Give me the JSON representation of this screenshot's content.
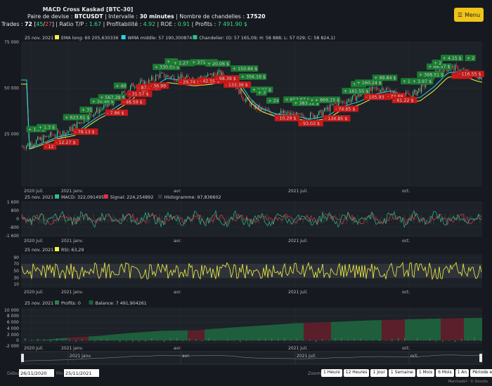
{
  "header": {
    "title": "MACD Cross Kaskad [BTC-30]",
    "pair_label": "Paire de devise :",
    "pair_value": "BTCUSDT",
    "interval_label": "| Intervalle :",
    "interval_value": "30 minutes",
    "candles_label": "| Nombre de chandelles :",
    "candles_value": "17520",
    "trades_label": "Trades :",
    "trades_total": "72",
    "trades_open_bracket": "[",
    "trades_wins": "45",
    "trades_sep": "/",
    "trades_losses": "27",
    "trades_close_bracket": "]",
    "ratio_label": "| Ratio T/P :",
    "ratio_value": "1.67",
    "profitability_label": "| Profitabilité :",
    "profitability_value": "4.92",
    "roe_label": "| ROE :",
    "roe_value": "0.91",
    "profits_label": "| Profits :",
    "profits_value": "7 491.90 $"
  },
  "menu": {
    "icon": "hamburger-icon",
    "label": "Menu"
  },
  "colors": {
    "background": "#16191f",
    "panel": "#1d2128",
    "ema": "#f4f442",
    "wma": "#29d3e6",
    "green": "#1e7a3a",
    "red": "#d21a1a",
    "accent": "#f0c419",
    "macd": "#2bbf8a",
    "signal": "#e0314d",
    "rsi": "#f4f442",
    "balance": "#1e5e3c"
  },
  "price_panel": {
    "date": "25 nov. 2021",
    "legend": [
      {
        "label": "EMA long: 60 205,630336",
        "color": "#f4f442"
      },
      {
        "label": "WMA middle: 57 190,300874",
        "color": "#29d3e6"
      },
      {
        "label": "Chandelier: (O: 57 165,09; H: 58 888; L: 57 029; C: 58 824,1)",
        "color": "#2bbf8a"
      }
    ],
    "y_ticks": [
      "75 000",
      "50 000",
      "25 000"
    ],
    "x_ticks": [
      "2020 juil.",
      "2021 janv.",
      "avr.",
      "2021 juil.",
      "oct."
    ],
    "trade_labels": [
      {
        "text": "+ 1.3 $",
        "type": "gain"
      },
      {
        "text": "+ 1.3 $",
        "type": "gain"
      },
      {
        "text": "- 12",
        "type": "loss"
      },
      {
        "text": "- 12.27 $",
        "type": "loss"
      },
      {
        "text": "+ 623.61 $",
        "type": "gain"
      },
      {
        "text": "- 78.13 $",
        "type": "loss"
      },
      {
        "text": "+ 31",
        "type": "gain"
      },
      {
        "text": "+ 30.46 $",
        "type": "gain"
      },
      {
        "text": "+ 567.39 $",
        "type": "gain"
      },
      {
        "text": "- 7.86 $",
        "type": "loss"
      },
      {
        "text": "+ 40",
        "type": "gain"
      },
      {
        "text": "- 48.59 $",
        "type": "loss"
      },
      {
        "text": "- 31.57 $",
        "type": "loss"
      },
      {
        "text": "- 87.94 $",
        "type": "loss"
      },
      {
        "text": "- 36.99",
        "type": "loss"
      },
      {
        "text": "+ 330.03 $",
        "type": "gain"
      },
      {
        "text": "+ 49",
        "type": "gain"
      },
      {
        "text": "+ 1.27 $",
        "type": "gain"
      },
      {
        "text": "- 29.74 $",
        "type": "loss"
      },
      {
        "text": "+ 371.75 $",
        "type": "gain"
      },
      {
        "text": "- 42.59 $",
        "type": "loss"
      },
      {
        "text": "+ 20.06 $",
        "type": "gain"
      },
      {
        "text": "- 98.39 $",
        "type": "loss"
      },
      {
        "text": "- 133.36 $",
        "type": "loss"
      },
      {
        "text": "+ 150.84 $",
        "type": "gain"
      },
      {
        "text": "+ 356.16 $",
        "type": "gain"
      },
      {
        "text": "+ 2.93 $",
        "type": "gain"
      },
      {
        "text": "+ 3",
        "type": "gain"
      },
      {
        "text": "+ 24",
        "type": "gain"
      },
      {
        "text": "- 10.29 $",
        "type": "loss"
      },
      {
        "text": "+ 652.97 $",
        "type": "gain"
      },
      {
        "text": "+ 383.12 $",
        "type": "gain"
      },
      {
        "text": "- 93.03 $",
        "type": "loss"
      },
      {
        "text": "+ 8.33 $",
        "type": "gain"
      },
      {
        "text": "+ 869.15 $",
        "type": "gain"
      },
      {
        "text": "- 134.85 $",
        "type": "loss"
      },
      {
        "text": "- 74.65 $",
        "type": "loss"
      },
      {
        "text": "+ 161.55 $",
        "type": "gain"
      },
      {
        "text": "+ 136",
        "type": "gain"
      },
      {
        "text": "+ 160.24 $",
        "type": "gain"
      },
      {
        "text": "- 105.93 $",
        "type": "loss"
      },
      {
        "text": "+ 99.84 $",
        "type": "gain"
      },
      {
        "text": "- 72.69",
        "type": "loss"
      },
      {
        "text": "- 61.22 $",
        "type": "loss"
      },
      {
        "text": "+ 112.15 $",
        "type": "gain"
      },
      {
        "text": "+ 3.97 $",
        "type": "gain"
      },
      {
        "text": "+ 368.51 $",
        "type": "gain"
      },
      {
        "text": "+ 66.57 $",
        "type": "gain"
      },
      {
        "text": "+ 2",
        "type": "gain"
      },
      {
        "text": "+ 4.15 $",
        "type": "gain"
      },
      {
        "text": "- 50.71",
        "type": "loss"
      },
      {
        "text": "- 116.55 $",
        "type": "loss"
      },
      {
        "text": "+ 2",
        "type": "gain"
      }
    ]
  },
  "macd_panel": {
    "date": "25 nov. 2021",
    "legend": [
      {
        "label": "MACD: 322,091495",
        "color": "#2bbf8a"
      },
      {
        "label": "Signal: 224,254892",
        "color": "#e0314d"
      },
      {
        "label": "Histogramme: 97,836602",
        "color": "#2b3b36"
      }
    ],
    "y_ticks": [
      "1 600",
      "800",
      "0",
      "-800",
      "-1 600"
    ],
    "x_ticks": [
      "2020 juil.",
      "2021 janv.",
      "avr.",
      "2021 juil.",
      "oct."
    ]
  },
  "rsi_panel": {
    "date": "25 nov. 2021",
    "legend": [
      {
        "label": "RSI: 63,29",
        "color": "#f4f442"
      }
    ],
    "y_ticks": [
      "90",
      "70",
      "50",
      "30",
      "10"
    ],
    "x_ticks": [
      "2020 juil.",
      "2021 janv.",
      "avr.",
      "2021 juil.",
      "oct."
    ]
  },
  "profit_panel": {
    "date": "25 nov. 2021",
    "legend": [
      {
        "label": "Profits: 0",
        "color": "#2e7d4f"
      },
      {
        "label": "Balance: 7 491,904261",
        "color": "#1e5e3c"
      }
    ],
    "y_ticks": [
      "10 000",
      "8 000",
      "6 000",
      "4 000",
      "2 000",
      "0",
      "-2 000"
    ],
    "x_ticks": [
      "2020 juil.",
      "2021 janv.",
      "avr.",
      "2021 juil.",
      "oct."
    ]
  },
  "navigator": {
    "x_ticks": [
      "2021 janv.",
      "avr.",
      "2021 juil.",
      "oct."
    ]
  },
  "footer": {
    "start_label": "Début",
    "start_value": "26/11/2020",
    "end_label": "Fin",
    "end_value": "25/11/2021",
    "zoom_label": "Zoom",
    "zoom_options": [
      "1 Heure",
      "12 Heures",
      "1 Jour",
      "1 Semaine",
      "1 Mois",
      "6 Mois",
      "1 An",
      "Période entière"
    ],
    "credit": "Marchadof - © Devolis"
  },
  "chart_data": [
    {
      "type": "line",
      "title": "",
      "x": [
        "2020 juil.",
        "2021 janv.",
        "avr.",
        "2021 juil.",
        "oct."
      ],
      "series": [
        {
          "name": "EMA long",
          "values": [
            19000,
            30000,
            48000,
            38000,
            55000
          ]
        },
        {
          "name": "WMA middle",
          "values": [
            18500,
            31000,
            50000,
            36000,
            57000
          ]
        }
      ],
      "ylim": [
        0,
        75000
      ]
    },
    {
      "type": "line",
      "title": "",
      "series": [
        {
          "name": "MACD",
          "values": [
            322.09
          ]
        },
        {
          "name": "Signal",
          "values": [
            224.25
          ]
        },
        {
          "name": "Histogramme",
          "values": [
            97.84
          ]
        }
      ],
      "ylim": [
        -1600,
        1600
      ]
    },
    {
      "type": "line",
      "title": "",
      "series": [
        {
          "name": "RSI",
          "values": [
            63.29
          ]
        }
      ],
      "ylim": [
        10,
        90
      ]
    },
    {
      "type": "area",
      "title": "",
      "x": [
        "2020 juil.",
        "2021 janv.",
        "avr.",
        "2021 juil.",
        "oct."
      ],
      "series": [
        {
          "name": "Balance",
          "values": [
            0,
            1000,
            3200,
            5800,
            7491.9
          ]
        }
      ],
      "ylim": [
        -2000,
        10000
      ]
    }
  ]
}
